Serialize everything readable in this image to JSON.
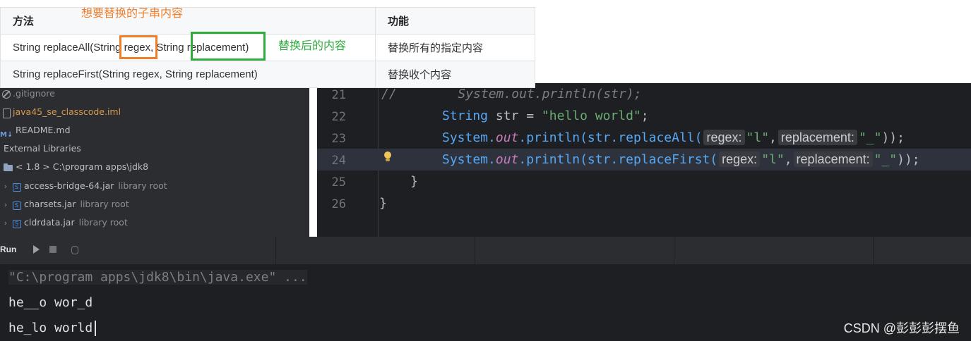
{
  "table": {
    "headers": [
      "方法",
      "功能"
    ],
    "rows": [
      {
        "method": "String replaceAll(String regex, String replacement)",
        "func": "替换所有的指定内容"
      },
      {
        "method": "String replaceFirst(String regex, String replacement)",
        "func": "替换收个内容"
      }
    ]
  },
  "annotations": {
    "regex_note": "想要替换的子串内容",
    "replacement_note": "替换后的内容"
  },
  "project_tree": [
    {
      "icon": "gitignore-icon",
      "label": ".gitignore",
      "color": "#bcbec4"
    },
    {
      "icon": "file-icon",
      "label": "java45_se_classcode.iml",
      "color": "#d99a4e"
    },
    {
      "icon": "markdown-icon",
      "label": "README.md",
      "color": "#bcbec4"
    },
    {
      "icon": "library-icon",
      "label": "External Libraries",
      "color": "#bcbec4"
    },
    {
      "icon": "folder-icon",
      "label": "< 1.8 >  C:\\program apps\\jdk8",
      "color": "#bcbec4"
    },
    {
      "icon": "jar-icon",
      "label": "access-bridge-64.jar",
      "suffix": "library root"
    },
    {
      "icon": "jar-icon",
      "label": "charsets.jar",
      "suffix": "library root"
    },
    {
      "icon": "jar-icon",
      "label": "cldrdata.jar",
      "suffix": "library root"
    }
  ],
  "editor": {
    "line_numbers": [
      "21",
      "22",
      "23",
      "24",
      "25",
      "26"
    ],
    "line21": "//        System.out.println(str);",
    "line22": {
      "type": "String",
      "var": " str = ",
      "str": "\"hello world\"",
      "end": ";"
    },
    "line23": {
      "cls": "System.",
      "field": "out",
      "call": ".println(str.",
      "method": "replaceAll(",
      "hint1": "regex:",
      "arg1": "\"l\"",
      "sep": ",",
      "hint2": "replacement:",
      "arg2": "\"_\"",
      "end": "));"
    },
    "line24": {
      "cls": "System.",
      "field": "out",
      "call": ".println(str.",
      "method": "replaceFirst(",
      "hint1": "regex:",
      "arg1": "\"l\"",
      "sep": ",",
      "hint2": "replacement:",
      "arg2": "\"_\"",
      "end": "));"
    },
    "line25": "}",
    "line26": "}"
  },
  "run": {
    "label": "Run"
  },
  "console": {
    "command": "\"C:\\program apps\\jdk8\\bin\\java.exe\" ...",
    "output": [
      "he__o wor_d",
      "he_lo world"
    ]
  },
  "watermark": "CSDN @彭彭彭摆鱼"
}
